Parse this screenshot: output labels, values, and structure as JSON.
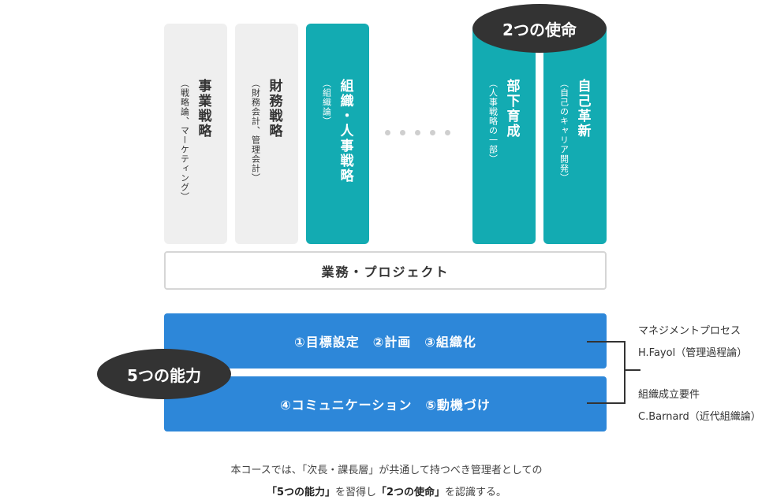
{
  "pillars": [
    {
      "title": "事業戦略",
      "sub": "（戦略論、マーケティング）"
    },
    {
      "title": "財務戦略",
      "sub": "（財務会計、管理会計）"
    },
    {
      "title": "組織・人事戦略",
      "sub": "（組織論）"
    },
    {
      "title": "部下育成",
      "sub": "（人事戦略の一部）"
    },
    {
      "title": "自己革新",
      "sub": "（自己のキャリア開発）"
    }
  ],
  "mission_label": "2つの使命",
  "project_label": "業務・プロジェクト",
  "ability_label": "5つの能力",
  "bars": {
    "top": "①目標設定　②計画　③組織化",
    "bottom": "④コミュニケーション　⑤動機づけ"
  },
  "notes": {
    "line1": "マネジメントプロセス",
    "line2": "H.Fayol（管理過程論）",
    "line3": "組織成立要件",
    "line4": "C.Barnard（近代組織論）"
  },
  "footer": {
    "line1": "本コースでは、「次長・課長層」が共通して持つべき管理者としての",
    "line2_a": "「5つの能力」",
    "line2_b": "を習得し",
    "line2_c": "「2つの使命」",
    "line2_d": "を認識する。"
  },
  "colors": {
    "teal": "#13abb2",
    "blue": "#2d87d9",
    "dark": "#333333",
    "gray": "#efefef"
  }
}
